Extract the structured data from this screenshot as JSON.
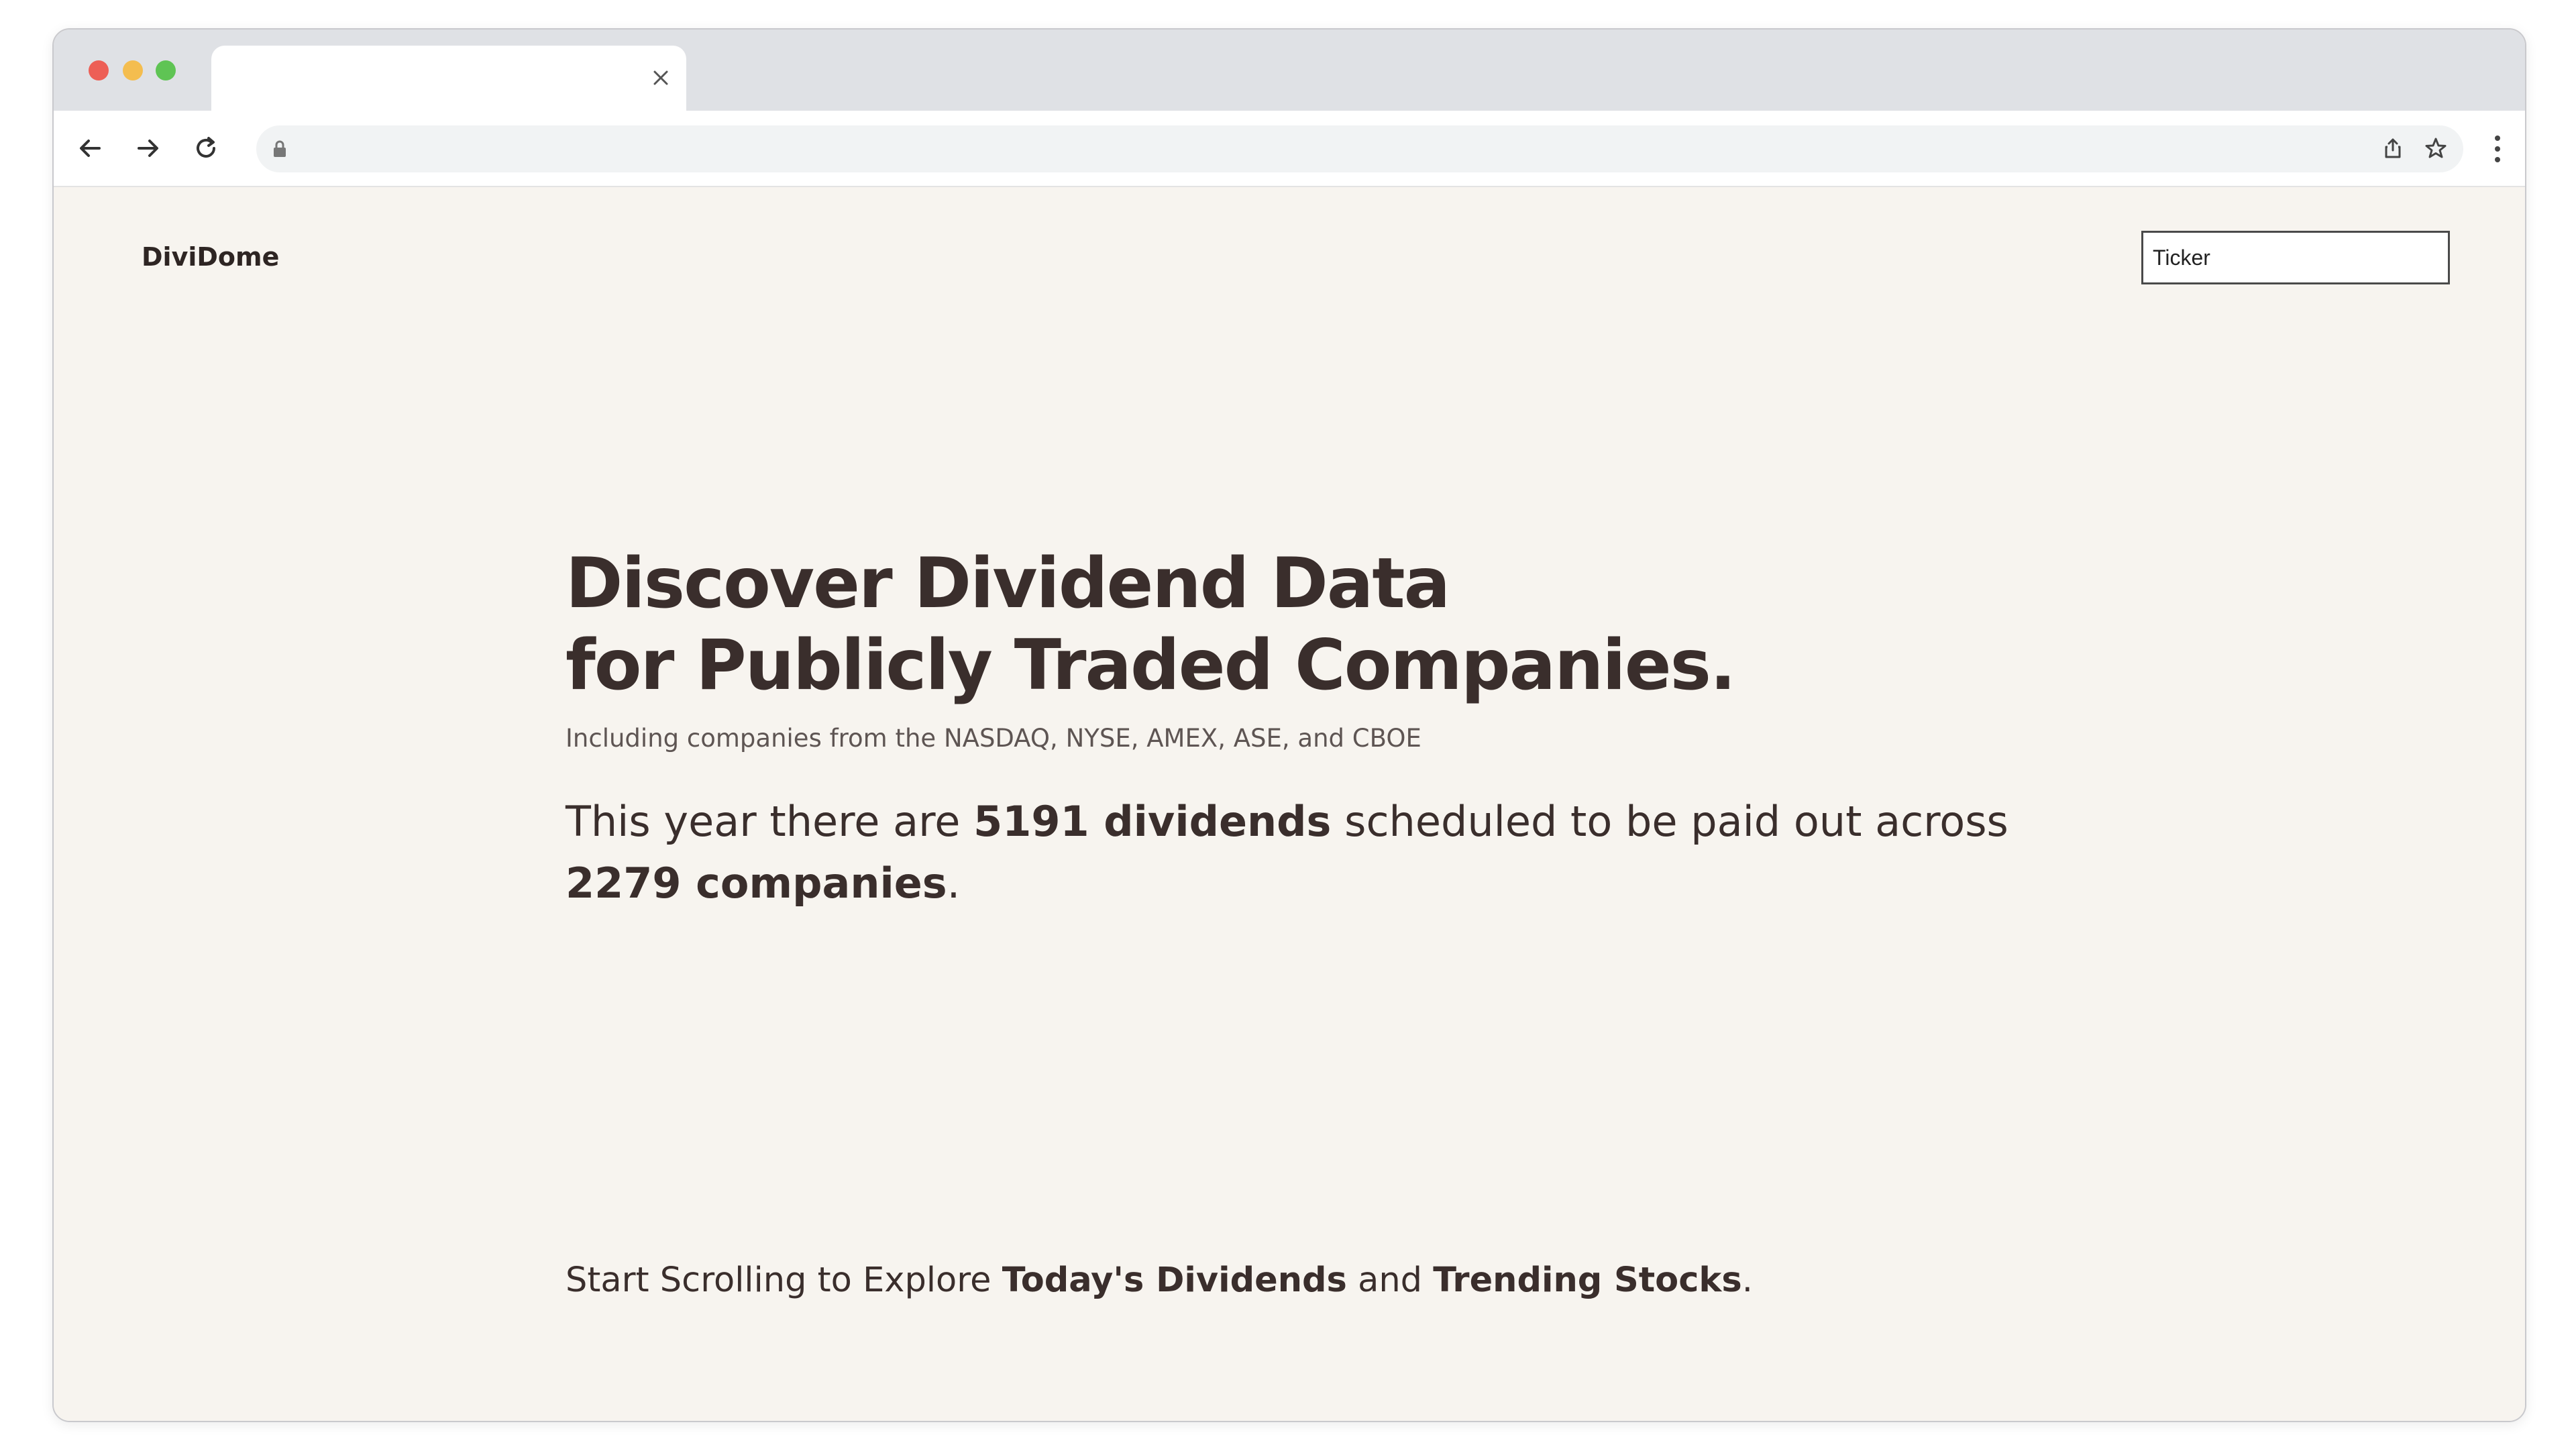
{
  "browser": {
    "tab_title": "",
    "url": "",
    "icons": {
      "close": "close-icon",
      "back": "arrow-left-icon",
      "forward": "arrow-right-icon",
      "reload": "reload-icon",
      "lock": "lock-icon",
      "share": "share-icon",
      "bookmark": "star-icon",
      "menu": "kebab-menu-icon"
    }
  },
  "header": {
    "brand": "DiviDome",
    "ticker_placeholder": "Ticker"
  },
  "hero": {
    "headline_line1": "Discover Dividend Data",
    "headline_line2": "for Publicly Traded Companies.",
    "subline": "Including companies from the NASDAQ, NYSE, AMEX, ASE, and CBOE",
    "stats_prefix": "This year there are ",
    "dividends_count": "5191 dividends",
    "stats_middle": " scheduled to be paid out across ",
    "companies_count": "2279 companies",
    "stats_suffix": "."
  },
  "scroll_hint": {
    "prefix": "Start Scrolling to Explore ",
    "link1": "Today's Dividends",
    "middle": " and ",
    "link2": "Trending Stocks",
    "suffix": "."
  },
  "colors": {
    "page_background": "#f7f4ef",
    "text": "#3a2e2c",
    "muted_text": "#5e5553"
  }
}
